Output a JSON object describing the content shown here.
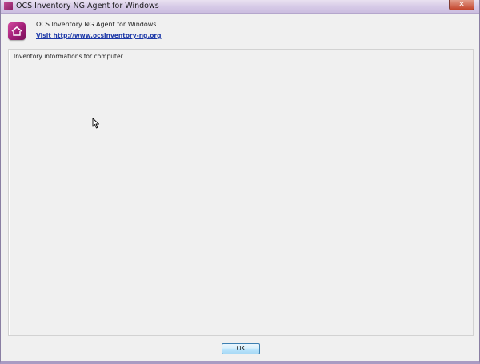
{
  "window": {
    "title": "OCS Inventory NG Agent for Windows",
    "close_label": "✕"
  },
  "header": {
    "app_name": "OCS Inventory NG Agent for Windows",
    "link_text": "Visit http://www.ocsinventory-ng.org"
  },
  "panel": {
    "status_text": "Inventory informations for computer..."
  },
  "footer": {
    "ok_label": "OK"
  },
  "colors": {
    "titlebar": "#d7cbe7",
    "logo": "#a21d77",
    "link": "#1e3aa8",
    "ok_button": "#bee6fd"
  },
  "icons": {
    "title_icon": "ocs-logo-icon",
    "header_icon": "ocs-logo-icon",
    "close": "close-icon",
    "cursor": "mouse-pointer-icon"
  }
}
